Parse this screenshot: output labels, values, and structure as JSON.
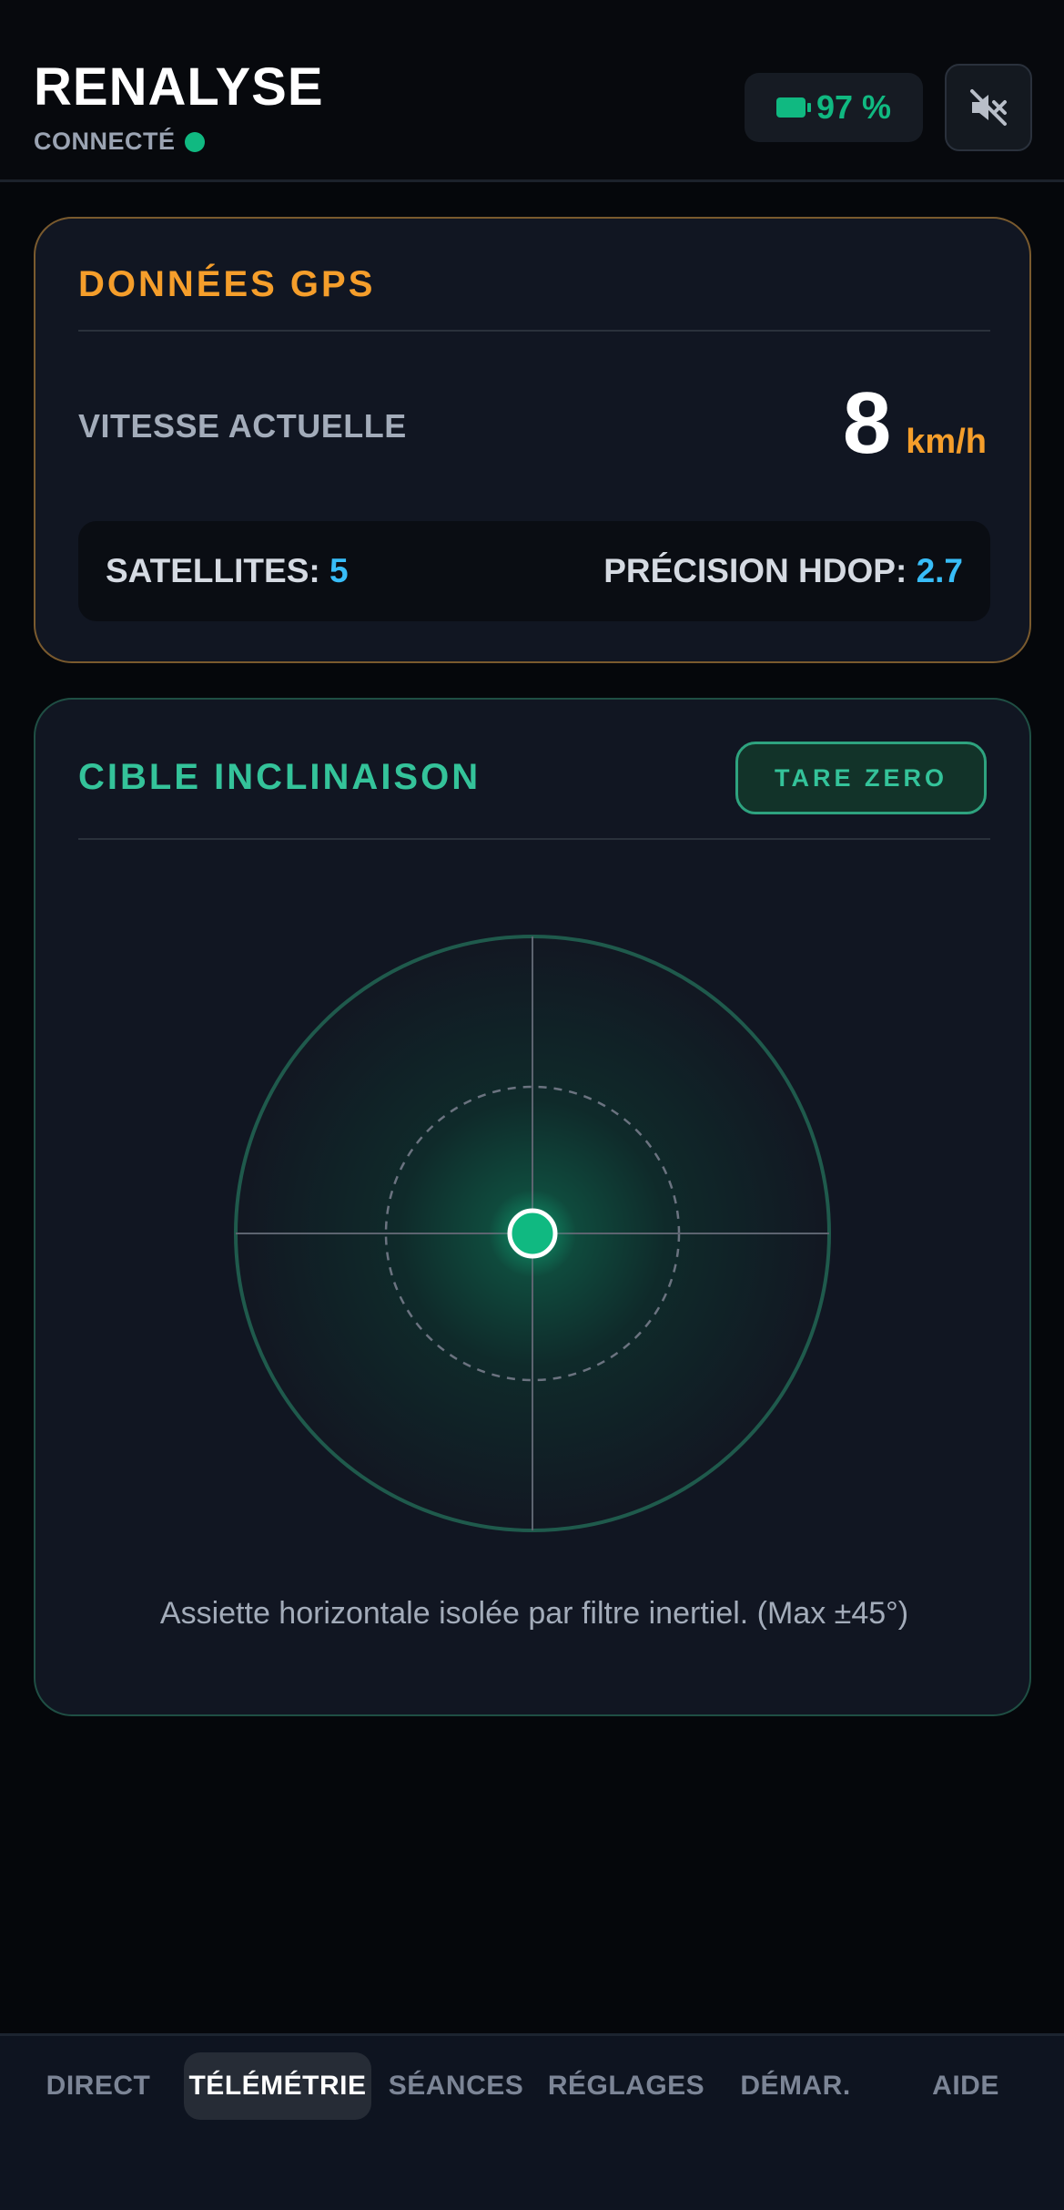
{
  "header": {
    "app_title": "RENALYSE",
    "status_label": "CONNECTÉ",
    "status_color": "#10b981",
    "battery_text": "97 %",
    "battery_icon": "battery-icon",
    "mute_icon": "speaker-muted-icon"
  },
  "gps": {
    "heading": "DONNÉES GPS",
    "speed_label": "VITESSE ACTUELLE",
    "speed_value": "8",
    "speed_unit": "km/h",
    "satellites_label": "SATELLITES:",
    "satellites_value": "5",
    "hdop_label": "PRÉCISION HDOP:",
    "hdop_value": "2.7",
    "accent_color": "#f59e2b"
  },
  "tilt": {
    "heading": "CIBLE INCLINAISON",
    "tare_button": "TARE ZERO",
    "indicator_x_deg": 0,
    "indicator_y_deg": 0,
    "note": "Assiette horizontale isolée par filtre inertiel. (Max ±45°)",
    "accent_color": "#34c39a"
  },
  "nav": {
    "items": [
      {
        "label": "DIRECT"
      },
      {
        "label": "TÉLÉMÉTRIE"
      },
      {
        "label": "SÉANCES"
      },
      {
        "label": "RÉGLAGES"
      },
      {
        "label": "DÉMAR."
      },
      {
        "label": "AIDE"
      }
    ],
    "active": "TÉLÉMÉTRIE"
  }
}
